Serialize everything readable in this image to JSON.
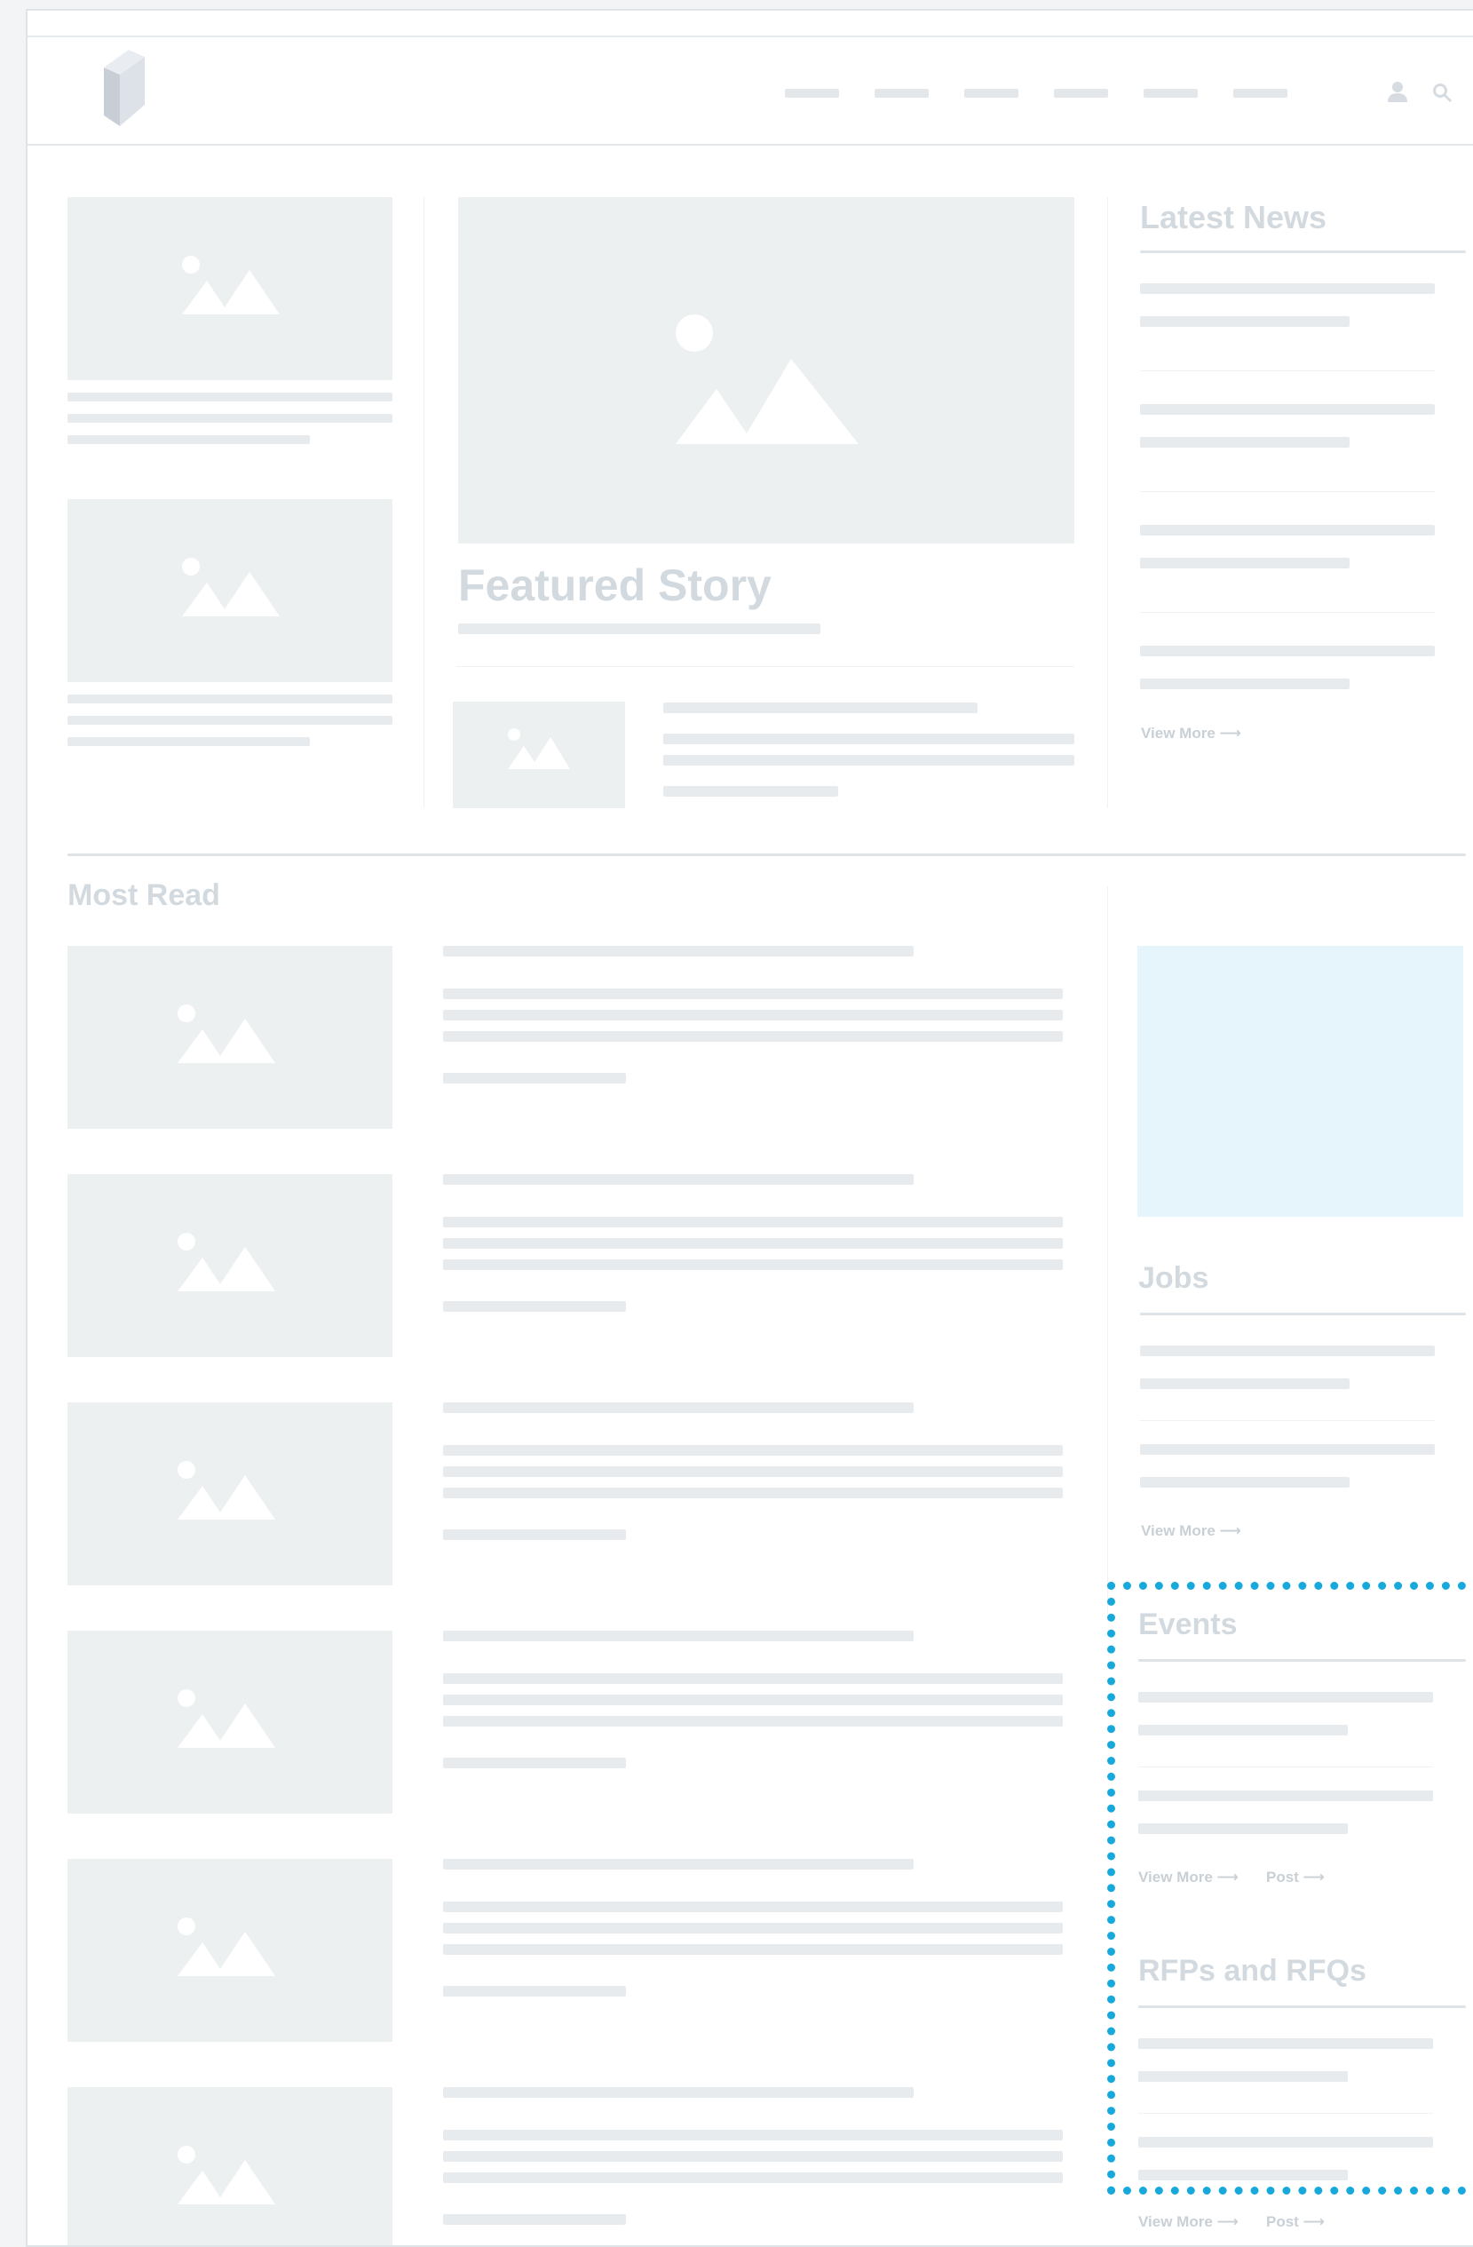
{
  "featured": {
    "title": "Featured Story"
  },
  "latest_news": {
    "title": "Latest News",
    "view_more": "View More ⟶"
  },
  "most_read": {
    "title": "Most Read"
  },
  "jobs": {
    "title": "Jobs",
    "view_more": "View More ⟶"
  },
  "events": {
    "title": "Events",
    "view_more": "View More ⟶",
    "post": "Post ⟶"
  },
  "rfps": {
    "title": "RFPs and RFQs",
    "view_more": "View More ⟶",
    "post": "Post ⟶"
  },
  "colors": {
    "placeholder": "#edf0f1",
    "line": "#e8ebee",
    "heading": "#d3dadf",
    "highlight": "#18a9dc",
    "ad": "#e6f5fc"
  },
  "icons": [
    "logo-icon",
    "user-icon",
    "search-icon",
    "image-placeholder-icon"
  ]
}
